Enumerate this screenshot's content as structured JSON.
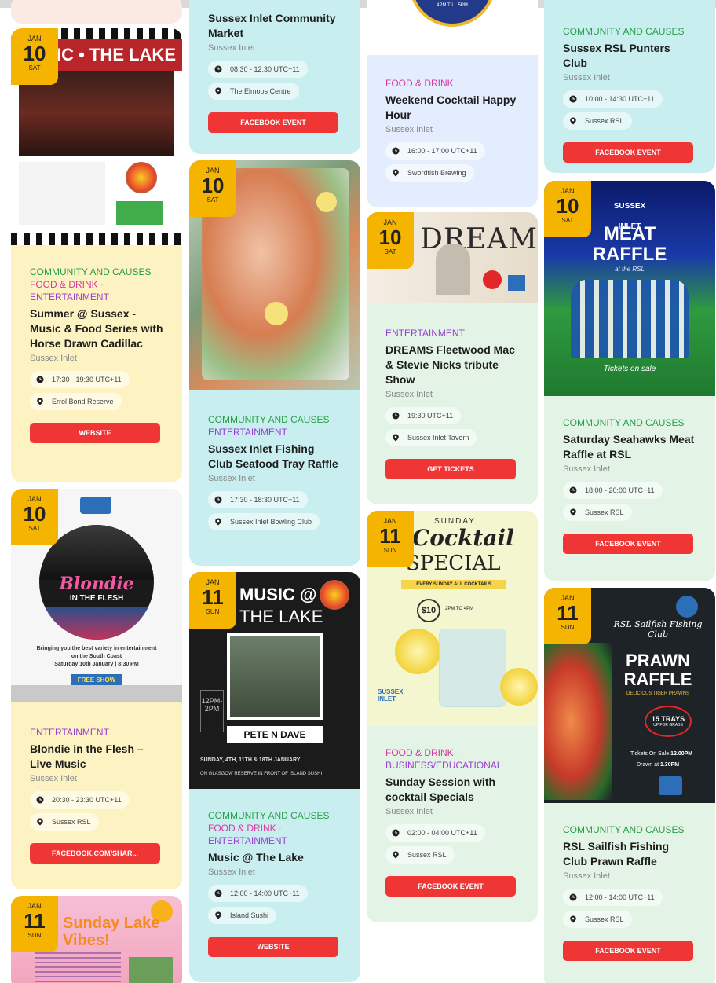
{
  "colors": {
    "badge": "#f5b400",
    "button": "#f03535",
    "community": "#27a046",
    "food": "#d63aa0",
    "entertainment": "#9a3fd0"
  },
  "top_bar_color": "#f3e9e6",
  "col1": {
    "card1": {
      "month": "JAN",
      "day": "10",
      "weekday": "SAT",
      "poster_text": "SIC • THE LAKE",
      "cats": [
        "COMMUNITY AND CAUSES",
        "FOOD & DRINK",
        "ENTERTAINMENT"
      ],
      "title": "Summer @ Sussex - Music & Food Series with Horse Drawn Cadillac",
      "location": "Sussex Inlet",
      "time": "17:30 - 19:30 UTC+11",
      "venue": "Errol Bond Reserve",
      "button": "WEBSITE"
    },
    "card2": {
      "month": "JAN",
      "day": "10",
      "weekday": "SAT",
      "poster_title": "Blondie",
      "poster_sub": "IN THE FLESH",
      "poster_line1": "Bringing you the best variety in entertainment",
      "poster_line2": "on the South Coast",
      "poster_line3": "Saturday 10th January | 8:30 PM",
      "poster_btn": "FREE SHOW",
      "cats": [
        "ENTERTAINMENT"
      ],
      "title": "Blondie in the Flesh – Live Music",
      "location": "Sussex Inlet",
      "time": "20:30 - 23:30 UTC+11",
      "venue": "Sussex RSL",
      "button": "FACEBOOK.COM/SHAR..."
    },
    "card3": {
      "month": "JAN",
      "day": "11",
      "weekday": "SUN",
      "poster_text": "Sunday Lake Vibes!"
    }
  },
  "col2": {
    "card1": {
      "title": "Sussex Inlet Community Market",
      "location": "Sussex Inlet",
      "time": "08:30 - 12:30 UTC+11",
      "venue": "The Elmoos Centre",
      "button": "FACEBOOK EVENT"
    },
    "card2": {
      "month": "JAN",
      "day": "10",
      "weekday": "SAT",
      "cats": [
        "COMMUNITY AND CAUSES",
        "ENTERTAINMENT"
      ],
      "title": "Sussex Inlet Fishing Club Seafood Tray Raffle",
      "location": "Sussex Inlet",
      "time": "17:30 - 18:30 UTC+11",
      "venue": "Sussex Inlet Bowling Club"
    },
    "card3": {
      "month": "JAN",
      "day": "11",
      "weekday": "SUN",
      "poster_title": "MUSIC @",
      "poster_title2": "THE LAKE",
      "poster_time": "12PM-2PM",
      "poster_names": "PETE N DAVE",
      "poster_dates": "SUNDAY, 4TH, 11TH & 18TH JANUARY",
      "poster_place": "ON GLASGOW RESERVE IN FRONT OF ISLAND SUSHI",
      "cats": [
        "COMMUNITY AND CAUSES",
        "FOOD & DRINK",
        "ENTERTAINMENT"
      ],
      "title": "Music @ The Lake",
      "location": "Sussex Inlet",
      "time": "12:00 - 14:00 UTC+11",
      "venue": "Island Sushi",
      "button": "WEBSITE"
    }
  },
  "col3": {
    "card1": {
      "poster_text": "4PM TILL 5PM",
      "cats": [
        "FOOD & DRINK"
      ],
      "title": "Weekend Cocktail Happy Hour",
      "location": "Sussex Inlet",
      "time": "16:00 - 17:00 UTC+11",
      "venue": "Swordfish Brewing"
    },
    "card2": {
      "month": "JAN",
      "day": "10",
      "weekday": "SAT",
      "poster_text": "DREAMS",
      "cats": [
        "ENTERTAINMENT"
      ],
      "title": "DREAMS Fleetwood Mac & Stevie Nicks tribute Show",
      "location": "Sussex Inlet",
      "time": "19:30 UTC+11",
      "venue": "Sussex Inlet Tavern",
      "button": "GET TICKETS"
    },
    "card3": {
      "month": "JAN",
      "day": "11",
      "weekday": "SUN",
      "poster_sunday": "SUNDAY",
      "poster_title": "Cocktail",
      "poster_title2": "SPECIAL",
      "poster_band": "EVERY SUNDAY ALL COCKTAILS",
      "poster_price": "$10",
      "poster_hours": "2PM TO 4PM",
      "poster_logo": "SUSSEX INLET",
      "cats": [
        "FOOD & DRINK",
        "BUSINESS/EDUCATIONAL"
      ],
      "title": "Sunday Session with cocktail Specials",
      "location": "Sussex Inlet",
      "time": "02:00 - 04:00 UTC+11",
      "venue": "Sussex RSL",
      "button": "FACEBOOK EVENT"
    }
  },
  "col4": {
    "card1": {
      "cats": [
        "COMMUNITY AND CAUSES"
      ],
      "title": "Sussex RSL Punters Club",
      "location": "Sussex Inlet",
      "time": "10:00 - 14:30 UTC+11",
      "venue": "Sussex RSL",
      "button": "FACEBOOK EVENT"
    },
    "card2": {
      "month": "JAN",
      "day": "10",
      "weekday": "SAT",
      "poster_logo": "SUSSEX INLET",
      "poster_title": "MEAT",
      "poster_title2": "RAFFLE",
      "poster_sub": "at the RSL",
      "poster_tickets": "Tickets on sale",
      "cats": [
        "COMMUNITY AND CAUSES"
      ],
      "title": "Saturday Seahawks Meat Raffle at RSL",
      "location": "Sussex Inlet",
      "time": "18:00 - 20:00 UTC+11",
      "venue": "Sussex RSL",
      "button": "FACEBOOK EVENT"
    },
    "card3": {
      "month": "JAN",
      "day": "11",
      "weekday": "SUN",
      "poster_club": "RSL Sailfish Fishing Club",
      "poster_title": "PRAWN",
      "poster_title2": "RAFFLE",
      "poster_sub": "DELICIOUS TIGER PRAWNS",
      "poster_trays": "15 TRAYS",
      "poster_trays_sub": "UP FOR GRABS",
      "poster_sale_label": "Tickets On Sale",
      "poster_sale": "12.00PM",
      "poster_drawn_label": "Drawn at",
      "poster_drawn": "1.30PM",
      "cats": [
        "COMMUNITY AND CAUSES"
      ],
      "title": "RSL Sailfish Fishing Club Prawn Raffle",
      "location": "Sussex Inlet",
      "time": "12:00 - 14:00 UTC+11",
      "venue": "Sussex RSL",
      "button": "FACEBOOK EVENT"
    }
  }
}
